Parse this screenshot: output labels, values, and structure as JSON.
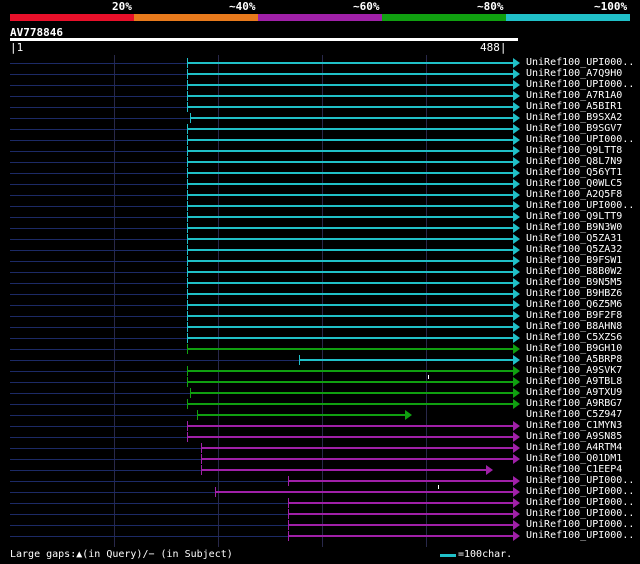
{
  "header": {
    "percent_labels": [
      "20%",
      "~40%",
      "~60%",
      "~80%",
      "~100%"
    ],
    "scale_colors": [
      "#e8102a",
      "#e87a1c",
      "#a020a8",
      "#10a010",
      "#20c0c8"
    ]
  },
  "query": {
    "name": "AV778846",
    "start": "1",
    "end": "488"
  },
  "hits": [
    {
      "label": "UniRef100_UPI000..",
      "color": "#20c0c8"
    },
    {
      "label": "UniRef100_A7Q9H0",
      "color": "#20c0c8"
    },
    {
      "label": "UniRef100_UPI000..",
      "color": "#20c0c8"
    },
    {
      "label": "UniRef100_A7R1A0",
      "color": "#20c0c8"
    },
    {
      "label": "UniRef100_A5BIR1",
      "color": "#20c0c8"
    },
    {
      "label": "UniRef100_B9SXA2",
      "color": "#20c0c8"
    },
    {
      "label": "UniRef100_B9SGV7",
      "color": "#20c0c8"
    },
    {
      "label": "UniRef100_UPI000..",
      "color": "#20c0c8"
    },
    {
      "label": "UniRef100_Q9LTT8",
      "color": "#20c0c8"
    },
    {
      "label": "UniRef100_Q8L7N9",
      "color": "#20c0c8"
    },
    {
      "label": "UniRef100_Q56YT1",
      "color": "#20c0c8"
    },
    {
      "label": "UniRef100_Q0WLC5",
      "color": "#20c0c8"
    },
    {
      "label": "UniRef100_A2Q5F8",
      "color": "#20c0c8"
    },
    {
      "label": "UniRef100_UPI000..",
      "color": "#20c0c8"
    },
    {
      "label": "UniRef100_Q9LTT9",
      "color": "#20c0c8"
    },
    {
      "label": "UniRef100_B9N3W0",
      "color": "#20c0c8"
    },
    {
      "label": "UniRef100_Q5ZA31",
      "color": "#20c0c8"
    },
    {
      "label": "UniRef100_Q5ZA32",
      "color": "#20c0c8"
    },
    {
      "label": "UniRef100_B9FSW1",
      "color": "#20c0c8"
    },
    {
      "label": "UniRef100_B8B0W2",
      "color": "#20c0c8"
    },
    {
      "label": "UniRef100_B9N5M5",
      "color": "#20c0c8"
    },
    {
      "label": "UniRef100_B9HBZ6",
      "color": "#20c0c8"
    },
    {
      "label": "UniRef100_Q6Z5M6",
      "color": "#20c0c8"
    },
    {
      "label": "UniRef100_B9F2F8",
      "color": "#20c0c8"
    },
    {
      "label": "UniRef100_B8AHN8",
      "color": "#20c0c8"
    },
    {
      "label": "UniRef100_C5XZS6",
      "color": "#20c0c8"
    },
    {
      "label": "UniRef100_B9GH10",
      "color": "#10a010"
    },
    {
      "label": "UniRef100_A5BRP8",
      "color": "#20c0c8"
    },
    {
      "label": "UniRef100_A9SVK7",
      "color": "#10a010"
    },
    {
      "label": "UniRef100_A9TBL8",
      "color": "#10a010"
    },
    {
      "label": "UniRef100_A9TXU9",
      "color": "#10a010"
    },
    {
      "label": "UniRef100_A9RBG7",
      "color": "#10a010"
    },
    {
      "label": "UniRef100_C5Z947",
      "color": "#10a010"
    },
    {
      "label": "UniRef100_C1MYN3",
      "color": "#a020a8"
    },
    {
      "label": "UniRef100_A9SN85",
      "color": "#a020a8"
    },
    {
      "label": "UniRef100_A4RTM4",
      "color": "#a020a8"
    },
    {
      "label": "UniRef100_Q01DM1",
      "color": "#a020a8"
    },
    {
      "label": "UniRef100_C1EEP4",
      "color": "#a020a8"
    },
    {
      "label": "UniRef100_UPI000..",
      "color": "#a020a8"
    },
    {
      "label": "UniRef100_UPI000..",
      "color": "#a020a8"
    },
    {
      "label": "UniRef100_UPI000..",
      "color": "#a020a8"
    },
    {
      "label": "UniRef100_UPI000..",
      "color": "#a020a8"
    },
    {
      "label": "UniRef100_UPI000..",
      "color": "#a020a8"
    },
    {
      "label": "UniRef100_UPI000..",
      "color": "#a020a8"
    }
  ],
  "legend": {
    "gaps_text": "Large gaps:▲(in Query)/− (in Subject)",
    "scale_text": "=100char."
  }
}
